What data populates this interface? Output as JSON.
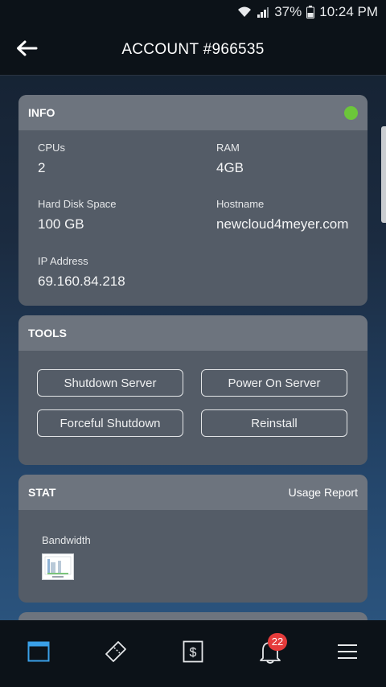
{
  "status_bar": {
    "battery": "37%",
    "time": "10:24 PM"
  },
  "header": {
    "title": "ACCOUNT #966535"
  },
  "info": {
    "title": "INFO",
    "fields": [
      {
        "label": "CPUs",
        "value": "2"
      },
      {
        "label": "RAM",
        "value": "4GB"
      },
      {
        "label": "Hard Disk Space",
        "value": "100 GB"
      },
      {
        "label": "Hostname",
        "value": "newcloud4meyer.com"
      },
      {
        "label": "IP Address",
        "value": "69.160.84.218"
      }
    ]
  },
  "tools": {
    "title": "TOOLS",
    "buttons": [
      "Shutdown Server",
      "Power On Server",
      "Forceful Shutdown",
      "Reinstall"
    ]
  },
  "stat": {
    "title": "STAT",
    "usage_link": "Usage Report",
    "bandwidth_label": "Bandwidth"
  },
  "bottom_nav": {
    "notification_count": "22"
  },
  "colors": {
    "accent": "#3aa0e8",
    "status_online": "#6cc63a",
    "badge": "#e53b3b",
    "card_body": "#545c67",
    "card_header": "#6d747e"
  },
  "icons": [
    "back-arrow-icon",
    "wifi-icon",
    "signal-icon",
    "battery-icon",
    "window-icon",
    "tag-icon",
    "dollar-icon",
    "bell-icon",
    "menu-icon"
  ]
}
